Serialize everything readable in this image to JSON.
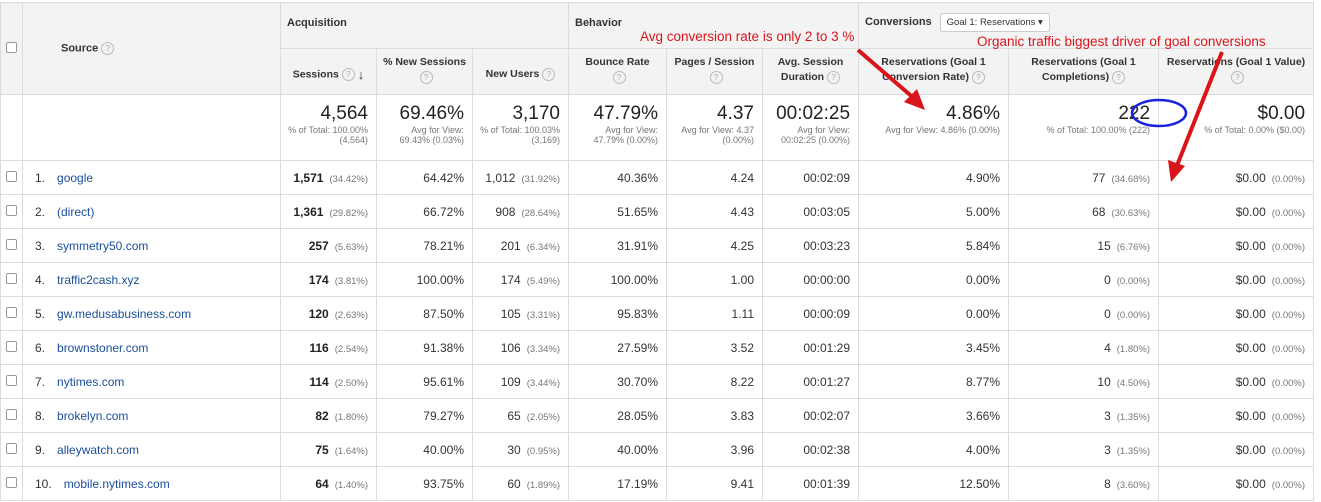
{
  "groups": {
    "source": "Source",
    "acquisition": "Acquisition",
    "behavior": "Behavior",
    "conversions": "Conversions",
    "goal_select": "Goal 1: Reservations"
  },
  "columns": {
    "sessions": "Sessions",
    "new_sessions": "% New Sessions",
    "new_users": "New Users",
    "bounce": "Bounce Rate",
    "pages": "Pages / Session",
    "duration": "Avg. Session Duration",
    "conv_rate": "Reservations (Goal 1 Conversion Rate)",
    "completions": "Reservations (Goal 1 Completions)",
    "value": "Reservations (Goal 1 Value)"
  },
  "totals": {
    "sessions": {
      "v": "4,564",
      "s": "% of Total: 100.00% (4,564)"
    },
    "new_sessions": {
      "v": "69.46%",
      "s": "Avg for View: 69.43% (0.03%)"
    },
    "new_users": {
      "v": "3,170",
      "s": "% of Total: 100.03% (3,169)"
    },
    "bounce": {
      "v": "47.79%",
      "s": "Avg for View: 47.79% (0.00%)"
    },
    "pages": {
      "v": "4.37",
      "s": "Avg for View: 4.37 (0.00%)"
    },
    "duration": {
      "v": "00:02:25",
      "s": "Avg for View: 00:02:25 (0.00%)"
    },
    "conv_rate": {
      "v": "4.86%",
      "s": "Avg for View: 4.86% (0.00%)"
    },
    "completions": {
      "v": "222",
      "s": "% of Total: 100.00% (222)"
    },
    "value": {
      "v": "$0.00",
      "s": "% of Total: 0.00% ($0.00)"
    }
  },
  "rows": [
    {
      "n": "1.",
      "src": "google",
      "ses": "1,571",
      "sesp": "(34.42%)",
      "ns": "64.42%",
      "nu": "1,012",
      "nup": "(31.92%)",
      "br": "40.36%",
      "ps": "4.24",
      "dur": "00:02:09",
      "cr": "4.90%",
      "comp": "77",
      "compp": "(34.68%)",
      "val": "$0.00",
      "valp": "(0.00%)"
    },
    {
      "n": "2.",
      "src": "(direct)",
      "ses": "1,361",
      "sesp": "(29.82%)",
      "ns": "66.72%",
      "nu": "908",
      "nup": "(28.64%)",
      "br": "51.65%",
      "ps": "4.43",
      "dur": "00:03:05",
      "cr": "5.00%",
      "comp": "68",
      "compp": "(30.63%)",
      "val": "$0.00",
      "valp": "(0.00%)"
    },
    {
      "n": "3.",
      "src": "symmetry50.com",
      "ses": "257",
      "sesp": "(5.63%)",
      "ns": "78.21%",
      "nu": "201",
      "nup": "(6.34%)",
      "br": "31.91%",
      "ps": "4.25",
      "dur": "00:03:23",
      "cr": "5.84%",
      "comp": "15",
      "compp": "(6.76%)",
      "val": "$0.00",
      "valp": "(0.00%)"
    },
    {
      "n": "4.",
      "src": "traffic2cash.xyz",
      "ses": "174",
      "sesp": "(3.81%)",
      "ns": "100.00%",
      "nu": "174",
      "nup": "(5.49%)",
      "br": "100.00%",
      "ps": "1.00",
      "dur": "00:00:00",
      "cr": "0.00%",
      "comp": "0",
      "compp": "(0.00%)",
      "val": "$0.00",
      "valp": "(0.00%)"
    },
    {
      "n": "5.",
      "src": "gw.medusabusiness.com",
      "ses": "120",
      "sesp": "(2.63%)",
      "ns": "87.50%",
      "nu": "105",
      "nup": "(3.31%)",
      "br": "95.83%",
      "ps": "1.11",
      "dur": "00:00:09",
      "cr": "0.00%",
      "comp": "0",
      "compp": "(0.00%)",
      "val": "$0.00",
      "valp": "(0.00%)"
    },
    {
      "n": "6.",
      "src": "brownstoner.com",
      "ses": "116",
      "sesp": "(2.54%)",
      "ns": "91.38%",
      "nu": "106",
      "nup": "(3.34%)",
      "br": "27.59%",
      "ps": "3.52",
      "dur": "00:01:29",
      "cr": "3.45%",
      "comp": "4",
      "compp": "(1.80%)",
      "val": "$0.00",
      "valp": "(0.00%)"
    },
    {
      "n": "7.",
      "src": "nytimes.com",
      "ses": "114",
      "sesp": "(2.50%)",
      "ns": "95.61%",
      "nu": "109",
      "nup": "(3.44%)",
      "br": "30.70%",
      "ps": "8.22",
      "dur": "00:01:27",
      "cr": "8.77%",
      "comp": "10",
      "compp": "(4.50%)",
      "val": "$0.00",
      "valp": "(0.00%)"
    },
    {
      "n": "8.",
      "src": "brokelyn.com",
      "ses": "82",
      "sesp": "(1.80%)",
      "ns": "79.27%",
      "nu": "65",
      "nup": "(2.05%)",
      "br": "28.05%",
      "ps": "3.83",
      "dur": "00:02:07",
      "cr": "3.66%",
      "comp": "3",
      "compp": "(1.35%)",
      "val": "$0.00",
      "valp": "(0.00%)"
    },
    {
      "n": "9.",
      "src": "alleywatch.com",
      "ses": "75",
      "sesp": "(1.64%)",
      "ns": "40.00%",
      "nu": "30",
      "nup": "(0.95%)",
      "br": "40.00%",
      "ps": "3.96",
      "dur": "00:02:38",
      "cr": "4.00%",
      "comp": "3",
      "compp": "(1.35%)",
      "val": "$0.00",
      "valp": "(0.00%)"
    },
    {
      "n": "10.",
      "src": "mobile.nytimes.com",
      "ses": "64",
      "sesp": "(1.40%)",
      "ns": "93.75%",
      "nu": "60",
      "nup": "(1.89%)",
      "br": "17.19%",
      "ps": "9.41",
      "dur": "00:01:39",
      "cr": "12.50%",
      "comp": "8",
      "compp": "(3.60%)",
      "val": "$0.00",
      "valp": "(0.00%)"
    }
  ],
  "annotations": {
    "a1": "Avg conversion rate is only 2 to 3 %",
    "a2": "Organic traffic biggest driver of goal conversions"
  }
}
